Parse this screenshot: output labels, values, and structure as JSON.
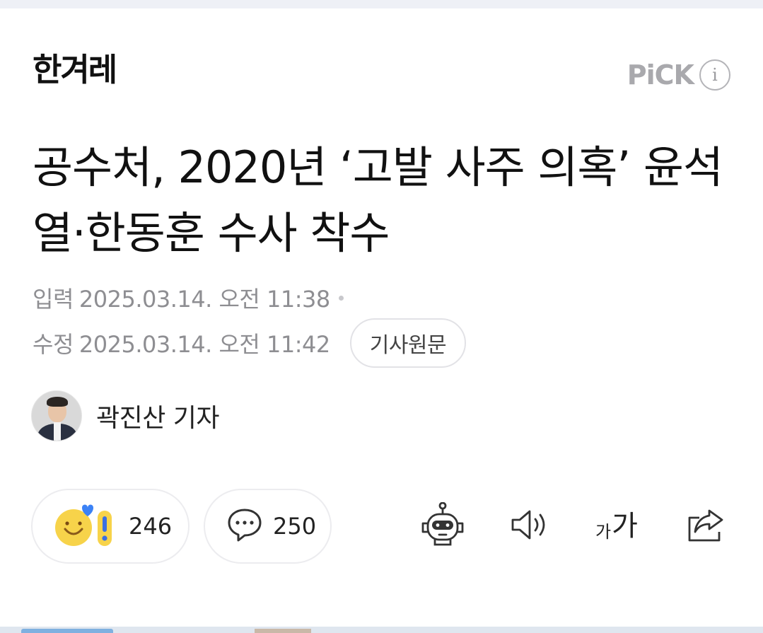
{
  "press": {
    "logo_text": "한겨레"
  },
  "pick": {
    "label": "PiCK",
    "info_icon": "i"
  },
  "article": {
    "headline": "공수처, 2020년 ‘고발 사주 의혹’ 윤석열·한동훈 수사 착수",
    "input_label": "입력",
    "input_datetime": "2025.03.14. 오전 11:38",
    "modified_label": "수정",
    "modified_datetime": "2025.03.14. 오전 11:42",
    "original_button": "기사원문"
  },
  "reporter": {
    "name": "곽진산 기자"
  },
  "actions": {
    "reaction_count": "246",
    "comment_count": "250",
    "font_size_small": "가",
    "font_size_big": "가"
  },
  "icons": {
    "reaction": "reaction-emoji-icon",
    "comment": "comment-bubble-icon",
    "summary_bot": "robot-icon",
    "audio": "speaker-icon",
    "font_size": "font-size-icon",
    "share": "share-icon"
  },
  "colors": {
    "background": "#ffffff",
    "headline": "#111111",
    "meta": "#8e8e92",
    "pick": "#a9a9ad",
    "pill_border": "#ececef",
    "emoji_yellow": "#f7d34a",
    "heart_blue": "#3b82f6"
  }
}
